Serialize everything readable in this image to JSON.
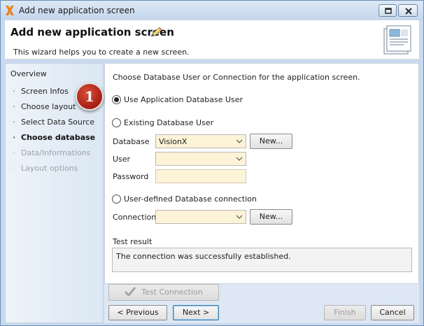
{
  "window": {
    "title": "Add new application screen"
  },
  "header": {
    "title": "Add new application screen",
    "subtitle": "This wizard helps you to create a new screen."
  },
  "nav": {
    "heading": "Overview",
    "items": [
      {
        "label": "Screen Infos",
        "state": "done"
      },
      {
        "label": "Choose layout",
        "state": "done"
      },
      {
        "label": "Select Data Source",
        "state": "done"
      },
      {
        "label": "Choose database",
        "state": "active"
      },
      {
        "label": "Data/Informations",
        "state": "pending"
      },
      {
        "label": "Layout options",
        "state": "pending"
      }
    ]
  },
  "main": {
    "prompt": "Choose Database User or Connection for the application screen.",
    "option_app_user": "Use Application Database User",
    "option_existing_user": "Existing Database User",
    "database_label": "Database",
    "database_value": "VisionX",
    "database_new_button": "New...",
    "user_label": "User",
    "user_value": "",
    "password_label": "Password",
    "password_value": "",
    "option_user_defined": "User-defined Database connection",
    "connection_label": "Connection",
    "connection_value": "",
    "connection_new_button": "New...",
    "test_result_heading": "Test result",
    "test_result_text": "The connection was successfully established.",
    "selected_option": "app_user"
  },
  "badge": {
    "number": "1"
  },
  "footer": {
    "test_connection": "Test Connection",
    "previous": "< Previous",
    "next": "Next >",
    "finish": "Finish",
    "cancel": "Cancel"
  },
  "colors": {
    "field_background": "#fdf3d6",
    "badge_red": "#c0392b",
    "nav_background": "#e6eef7"
  }
}
